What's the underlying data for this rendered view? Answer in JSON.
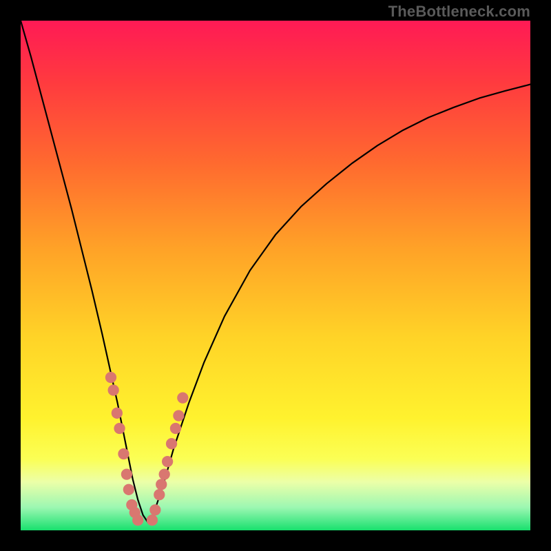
{
  "watermark": "TheBottleneck.com",
  "colors": {
    "frame": "#000000",
    "curve": "#000000",
    "marker": "#d97770",
    "gradient_stops": [
      {
        "offset": 0.0,
        "color": "#ff1a55"
      },
      {
        "offset": 0.12,
        "color": "#ff3a3f"
      },
      {
        "offset": 0.28,
        "color": "#ff6a2f"
      },
      {
        "offset": 0.45,
        "color": "#ffa327"
      },
      {
        "offset": 0.62,
        "color": "#ffd327"
      },
      {
        "offset": 0.78,
        "color": "#fff22e"
      },
      {
        "offset": 0.86,
        "color": "#fbff55"
      },
      {
        "offset": 0.905,
        "color": "#ecffa8"
      },
      {
        "offset": 0.955,
        "color": "#9cf7b2"
      },
      {
        "offset": 1.0,
        "color": "#18e06e"
      }
    ]
  },
  "chart_data": {
    "type": "line",
    "title": "",
    "xlabel": "",
    "ylabel": "",
    "xlim": [
      0,
      100
    ],
    "ylim": [
      0,
      100
    ],
    "grid": false,
    "legend": false,
    "series": [
      {
        "name": "bottleneck-curve",
        "x": [
          0,
          2,
          4,
          6,
          8,
          10,
          12,
          14,
          16,
          17,
          18,
          19,
          20,
          21,
          22,
          23,
          24,
          25,
          26,
          28,
          30,
          33,
          36,
          40,
          45,
          50,
          55,
          60,
          65,
          70,
          75,
          80,
          85,
          90,
          95,
          100
        ],
        "y": [
          100,
          93,
          85.5,
          78,
          70.5,
          63,
          55,
          47,
          38.5,
          34,
          29.5,
          25,
          20,
          15,
          10,
          6,
          3,
          1.5,
          3,
          9,
          16,
          25,
          33,
          42,
          51,
          58,
          63.5,
          68,
          72,
          75.5,
          78.5,
          81,
          83,
          84.8,
          86.2,
          87.5
        ]
      }
    ],
    "markers_left": {
      "x": [
        17.7,
        18.2,
        18.9,
        19.4,
        20.2,
        20.8,
        21.2,
        21.8,
        22.4,
        23.0
      ],
      "y": [
        30,
        27.5,
        23,
        20,
        15,
        11,
        8,
        5,
        3.5,
        2
      ]
    },
    "markers_right": {
      "x": [
        25.8,
        26.4,
        27.2,
        27.6,
        28.2,
        28.8,
        29.6,
        30.4,
        31.0,
        31.8
      ],
      "y": [
        2,
        4,
        7,
        9,
        11,
        13.5,
        17,
        20,
        22.5,
        26
      ]
    },
    "marker_radius": 1.1
  }
}
